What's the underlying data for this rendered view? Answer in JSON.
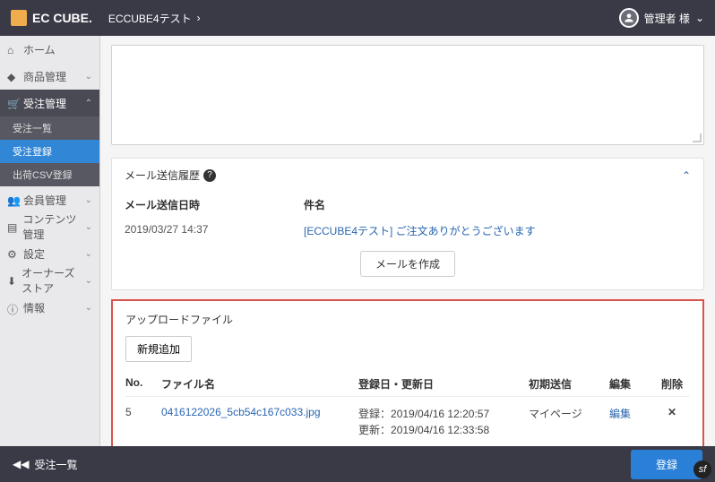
{
  "header": {
    "logo_text": "EC CUBE.",
    "breadcrumb": "ECCUBE4テスト",
    "breadcrumb_chevron": "›",
    "user_label": "管理者 様",
    "user_chevron": "⌄"
  },
  "sidebar": {
    "home": "ホーム",
    "product": "商品管理",
    "order": "受注管理",
    "order_sub1": "受注一覧",
    "order_sub2": "受注登録",
    "order_sub3": "出荷CSV登録",
    "member": "会員管理",
    "content": "コンテンツ管理",
    "setting": "設定",
    "owners": "オーナーズストア",
    "info": "情報"
  },
  "mail": {
    "title": "メール送信履歴",
    "col_datetime": "メール送信日時",
    "col_subject": "件名",
    "row_datetime": "2019/03/27 14:37",
    "row_subject": "[ECCUBE4テスト] ご注文ありがとうございます",
    "compose_btn": "メールを作成"
  },
  "upload": {
    "title": "アップロードファイル",
    "add_btn": "新規追加",
    "col_no": "No.",
    "col_filename": "ファイル名",
    "col_dates": "登録日・更新日",
    "col_initsale": "初期送信",
    "col_edit": "編集",
    "col_delete": "削除",
    "row": {
      "no": "5",
      "filename": "0416122026_5cb54c167c033.jpg",
      "created_lbl": "登録：",
      "created_val": "2019/04/16 12:20:57",
      "updated_lbl": "更新：",
      "updated_val": "2019/04/16 12:33:58",
      "initsale": "マイページ",
      "edit": "編集",
      "delete": "✕"
    }
  },
  "footer": {
    "back_icon": "◀◀",
    "back_label": "受注一覧",
    "save": "登録"
  },
  "sf_badge": "sf"
}
